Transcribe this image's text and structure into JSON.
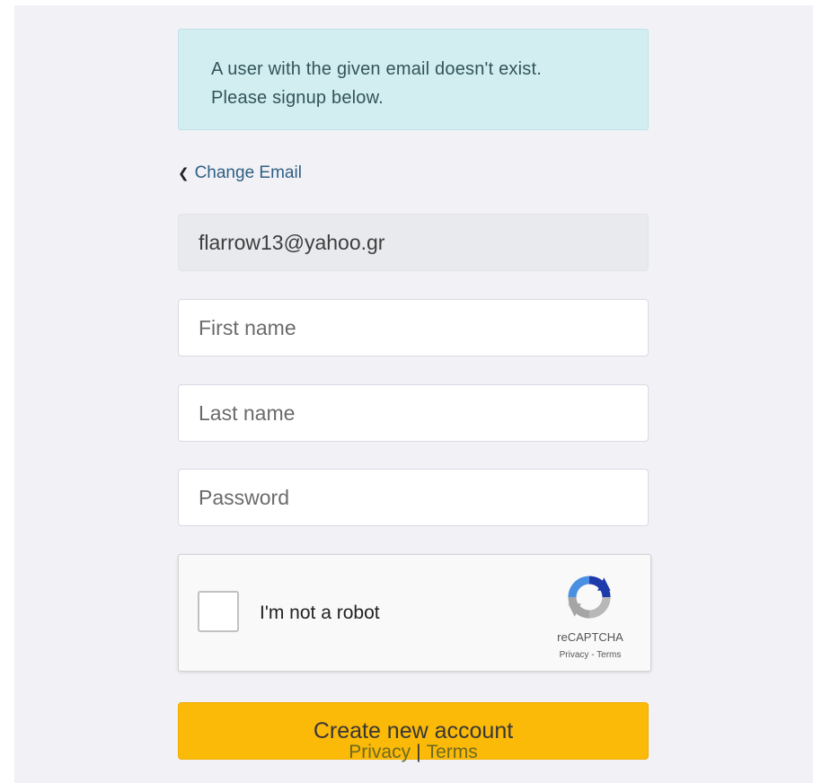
{
  "alert": {
    "line1": "A user with the given email doesn't exist.",
    "line2": "Please signup below.",
    "bg_color": "#d2eef1"
  },
  "back_link": {
    "icon": "chevron-left-icon",
    "label": "Change Email"
  },
  "form": {
    "email_value": "flarrow13@yahoo.gr",
    "first_name_placeholder": "First name",
    "last_name_placeholder": "Last name",
    "password_placeholder": "Password"
  },
  "recaptcha": {
    "checkbox_label": "I'm not a robot",
    "brand": "reCAPTCHA",
    "privacy_link": "Privacy",
    "separator": " - ",
    "terms_link": "Terms",
    "logo_icon": "recaptcha-logo-icon"
  },
  "submit": {
    "label": "Create new account",
    "color": "#fbb908"
  },
  "footer": {
    "privacy": "Privacy",
    "separator": "|",
    "terms": "Terms"
  }
}
